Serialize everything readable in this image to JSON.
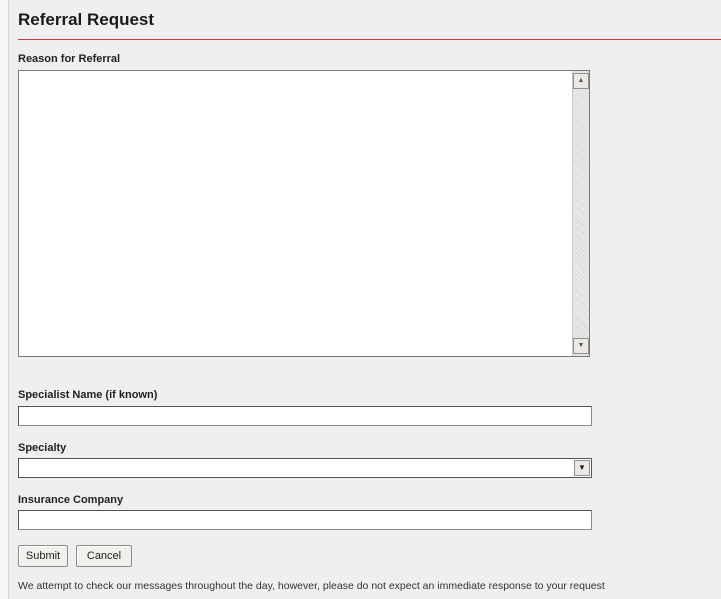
{
  "page": {
    "title": "Referral Request"
  },
  "form": {
    "reason_label": "Reason for Referral",
    "reason_value": "",
    "specialist_label": "Specialist Name (if known)",
    "specialist_value": "",
    "specialty_label": "Specialty",
    "specialty_selected": "",
    "insurance_label": "Insurance Company",
    "insurance_value": ""
  },
  "buttons": {
    "submit_label": "Submit",
    "cancel_label": "Cancel"
  },
  "footer": {
    "note": "We attempt to check our messages throughout the day, however, please do not expect an immediate response to your request"
  },
  "icons": {
    "scroll_up": "scroll-up-arrow-icon",
    "scroll_down": "scroll-down-arrow-icon",
    "dropdown": "dropdown-arrow-icon"
  },
  "colors": {
    "title_rule": "#c43a3a",
    "background": "#efefef"
  }
}
